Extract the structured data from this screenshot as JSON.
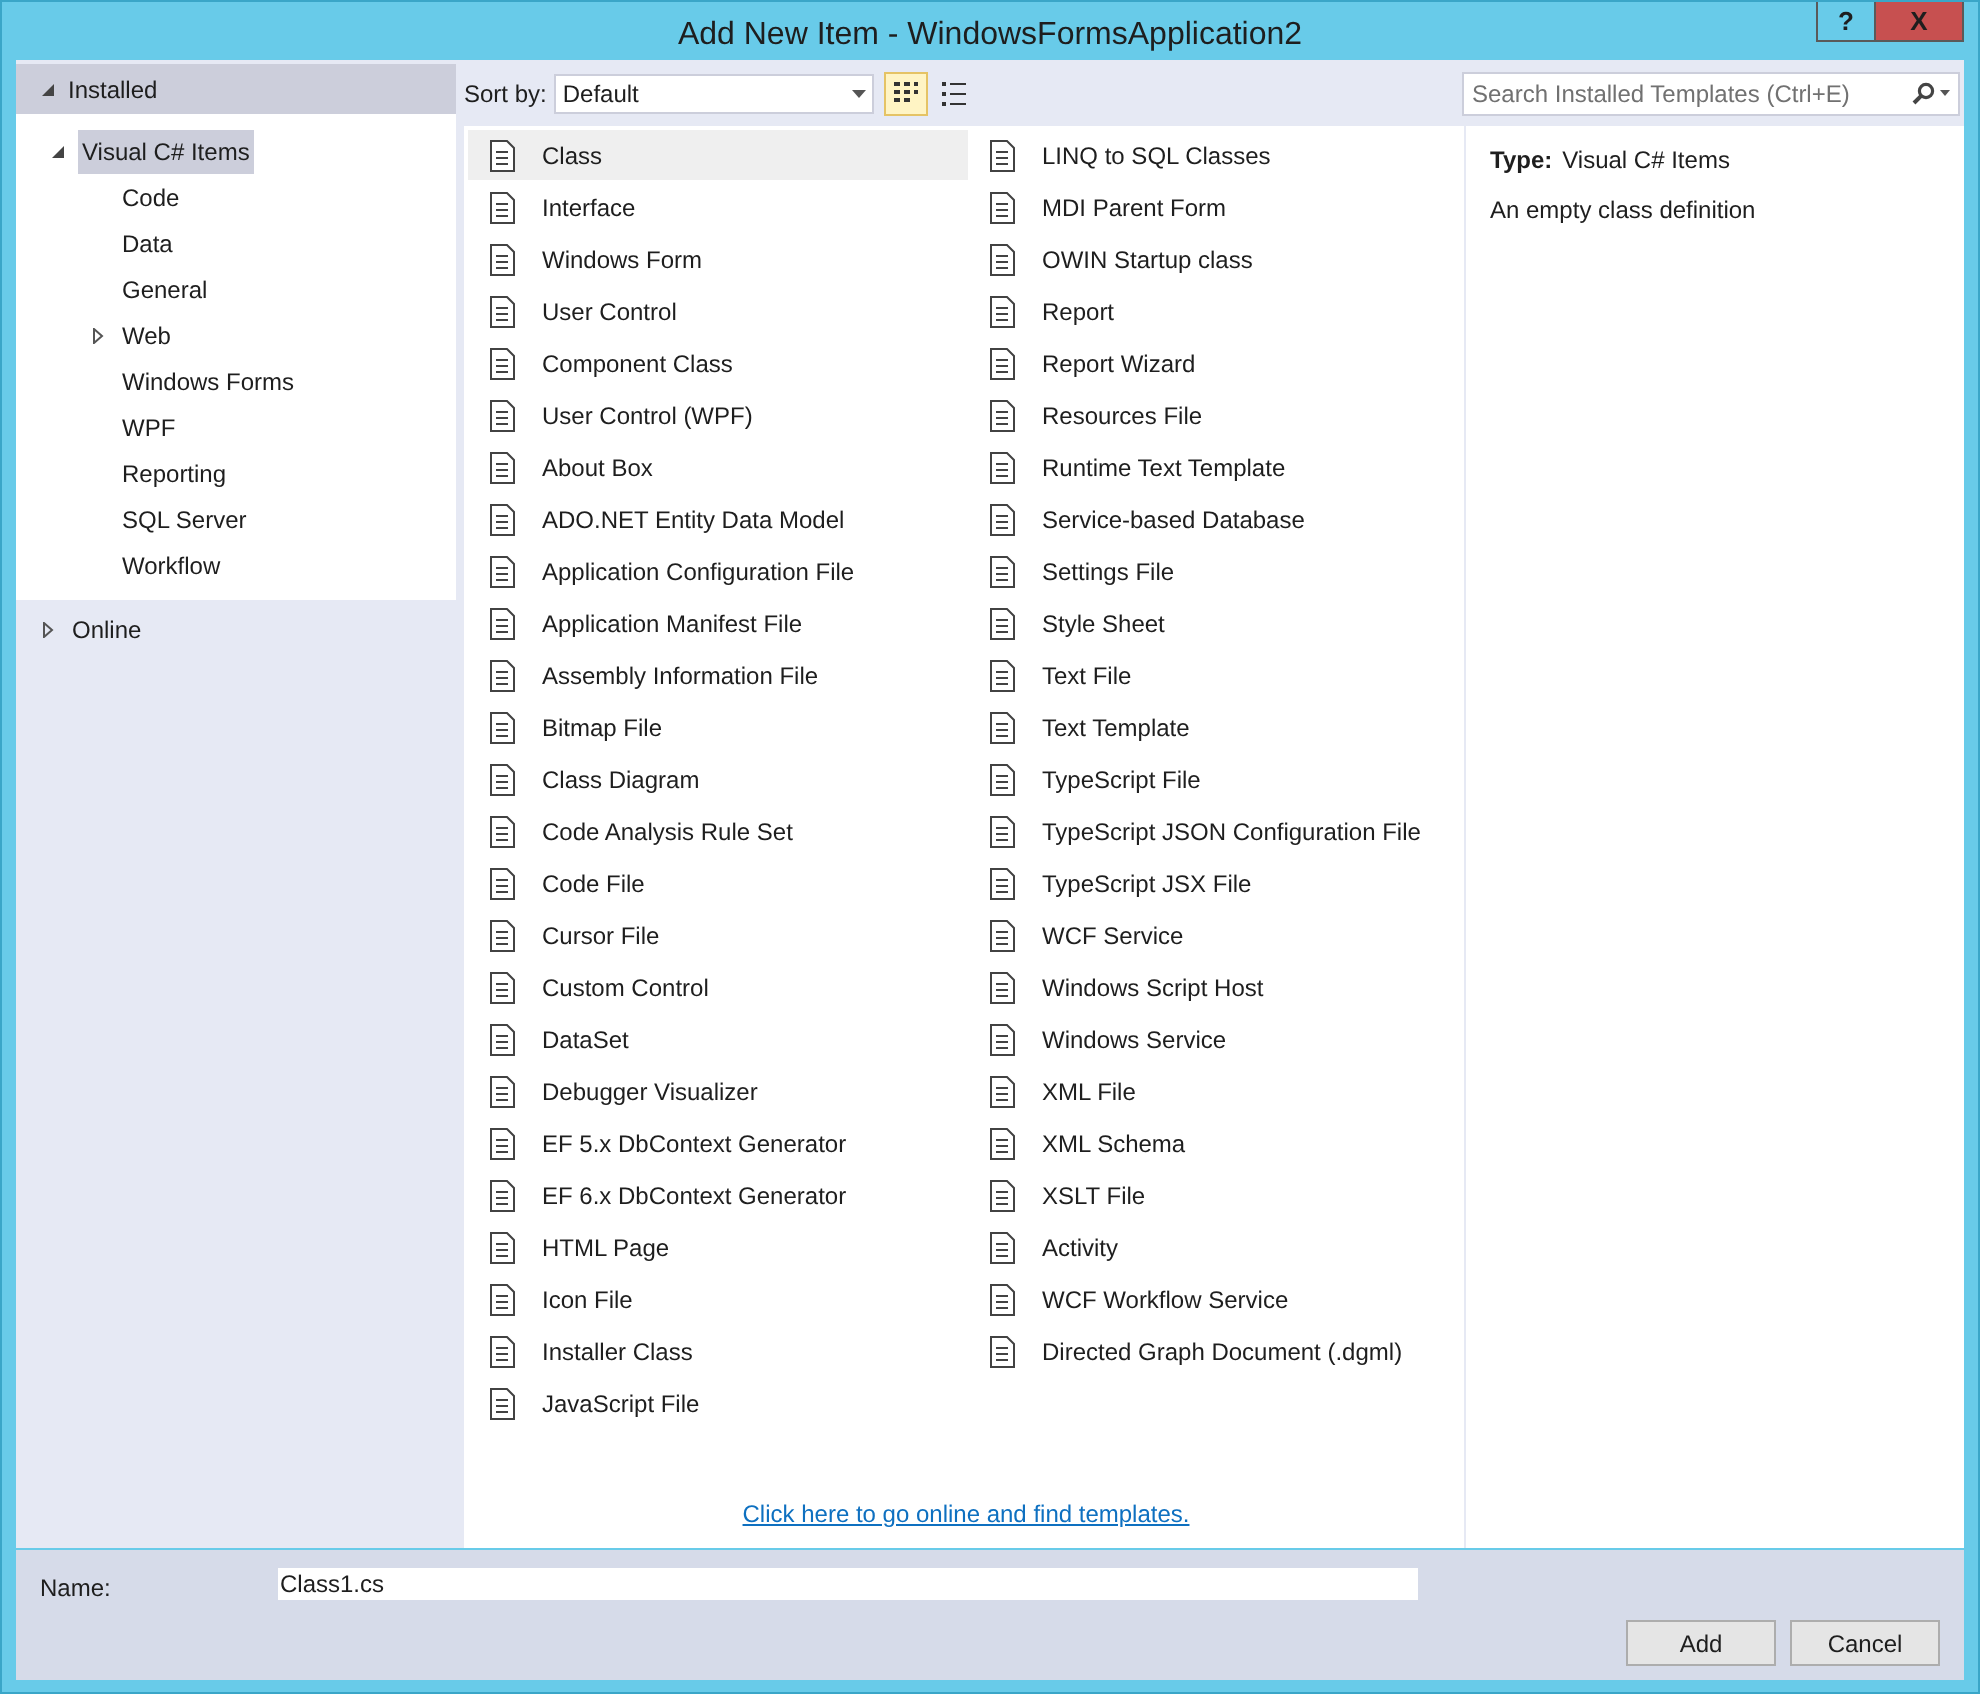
{
  "window": {
    "title": "Add New Item - WindowsFormsApplication2",
    "controls": [
      {
        "kind": "help",
        "label": "?"
      },
      {
        "kind": "close",
        "label": "X"
      }
    ]
  },
  "tree": [
    {
      "label": "Installed",
      "expanded": true,
      "selected": false,
      "children": [
        {
          "label": "Visual C# Items",
          "expanded": true,
          "selected": true,
          "children": [
            {
              "label": "Code",
              "selected": false
            },
            {
              "label": "Data",
              "selected": false
            },
            {
              "label": "General",
              "selected": false
            },
            {
              "label": "Web",
              "selected": false,
              "expanded": false
            },
            {
              "label": "Windows Forms",
              "selected": false
            },
            {
              "label": "WPF",
              "selected": false
            },
            {
              "label": "Reporting",
              "selected": false
            },
            {
              "label": "SQL Server",
              "selected": false
            },
            {
              "label": "Workflow",
              "selected": false
            }
          ]
        }
      ]
    },
    {
      "label": "Online",
      "expanded": false,
      "selected": false
    }
  ],
  "toolbar": {
    "sort_label": "Sort by:",
    "sort_value": "Default",
    "views": [
      {
        "kind": "grid",
        "selected": true
      },
      {
        "kind": "list",
        "selected": false
      }
    ],
    "search": {
      "placeholder": "Search Installed Templates (Ctrl+E)"
    }
  },
  "templates": [
    {
      "label": "Class",
      "selected": true
    },
    {
      "label": "Interface",
      "selected": false
    },
    {
      "label": "Windows Form",
      "selected": false
    },
    {
      "label": "User Control",
      "selected": false
    },
    {
      "label": "Component Class",
      "selected": false
    },
    {
      "label": "User Control (WPF)",
      "selected": false
    },
    {
      "label": "About Box",
      "selected": false
    },
    {
      "label": "ADO.NET Entity Data Model",
      "selected": false
    },
    {
      "label": "Application Configuration File",
      "selected": false
    },
    {
      "label": "Application Manifest File",
      "selected": false
    },
    {
      "label": "Assembly Information File",
      "selected": false
    },
    {
      "label": "Bitmap File",
      "selected": false
    },
    {
      "label": "Class Diagram",
      "selected": false
    },
    {
      "label": "Code Analysis Rule Set",
      "selected": false
    },
    {
      "label": "Code File",
      "selected": false
    },
    {
      "label": "Cursor File",
      "selected": false
    },
    {
      "label": "Custom Control",
      "selected": false
    },
    {
      "label": "DataSet",
      "selected": false
    },
    {
      "label": "Debugger Visualizer",
      "selected": false
    },
    {
      "label": "EF 5.x DbContext Generator",
      "selected": false
    },
    {
      "label": "EF 6.x DbContext Generator",
      "selected": false
    },
    {
      "label": "HTML Page",
      "selected": false
    },
    {
      "label": "Icon File",
      "selected": false
    },
    {
      "label": "Installer Class",
      "selected": false
    },
    {
      "label": "JavaScript File",
      "selected": false
    },
    {
      "label": "LINQ to SQL Classes",
      "selected": false
    },
    {
      "label": "MDI Parent Form",
      "selected": false
    },
    {
      "label": "OWIN Startup class",
      "selected": false
    },
    {
      "label": "Report",
      "selected": false
    },
    {
      "label": "Report Wizard",
      "selected": false
    },
    {
      "label": "Resources File",
      "selected": false
    },
    {
      "label": "Runtime Text Template",
      "selected": false
    },
    {
      "label": "Service-based Database",
      "selected": false
    },
    {
      "label": "Settings File",
      "selected": false
    },
    {
      "label": "Style Sheet",
      "selected": false
    },
    {
      "label": "Text File",
      "selected": false
    },
    {
      "label": "Text Template",
      "selected": false
    },
    {
      "label": "TypeScript File",
      "selected": false
    },
    {
      "label": "TypeScript JSON Configuration File",
      "selected": false
    },
    {
      "label": "TypeScript JSX File",
      "selected": false
    },
    {
      "label": "WCF Service",
      "selected": false
    },
    {
      "label": "Windows Script Host",
      "selected": false
    },
    {
      "label": "Windows Service",
      "selected": false
    },
    {
      "label": "XML File",
      "selected": false
    },
    {
      "label": "XML Schema",
      "selected": false
    },
    {
      "label": "XSLT File",
      "selected": false
    },
    {
      "label": "Activity",
      "selected": false
    },
    {
      "label": "WCF Workflow Service",
      "selected": false
    },
    {
      "label": "Directed Graph Document (.dgml)",
      "selected": false
    }
  ],
  "online_link": "Click here to go online and find templates.",
  "details": {
    "type_label": "Type:",
    "type_value": "Visual C# Items",
    "description": "An empty class definition"
  },
  "name_field": {
    "label": "Name:",
    "value": "Class1.cs"
  },
  "buttons": [
    "Add",
    "Cancel"
  ]
}
